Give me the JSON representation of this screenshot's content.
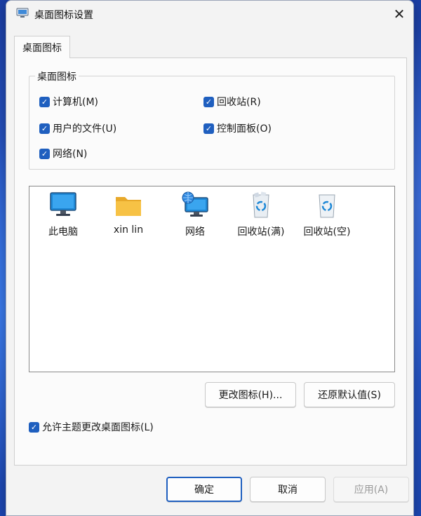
{
  "window": {
    "title": "桌面图标设置",
    "close_glyph": "✕"
  },
  "tabs": [
    {
      "label": "桌面图标",
      "selected": true
    }
  ],
  "desktop_icons_group": {
    "legend": "桌面图标",
    "items": [
      {
        "label": "计算机(M)",
        "checked": true
      },
      {
        "label": "回收站(R)",
        "checked": true
      },
      {
        "label": "用户的文件(U)",
        "checked": true
      },
      {
        "label": "控制面板(O)",
        "checked": true
      },
      {
        "label": "网络(N)",
        "checked": true
      }
    ]
  },
  "icon_list": [
    {
      "label": "此电脑",
      "icon": "monitor-icon"
    },
    {
      "label": "xin lin",
      "icon": "folder-icon"
    },
    {
      "label": "网络",
      "icon": "network-globe-icon"
    },
    {
      "label": "回收站(满)",
      "icon": "recycle-bin-full-icon"
    },
    {
      "label": "回收站(空)",
      "icon": "recycle-bin-empty-icon"
    }
  ],
  "buttons": {
    "change_icon": "更改图标(H)...",
    "restore_default": "还原默认值(S)",
    "ok": "确定",
    "cancel": "取消",
    "apply": "应用(A)"
  },
  "allow_themes": {
    "label": "允许主题更改桌面图标(L)",
    "checked": true
  },
  "colors": {
    "accent": "#1f5fbf",
    "monitor": "#1e88d6",
    "folder": "#f7c245"
  }
}
